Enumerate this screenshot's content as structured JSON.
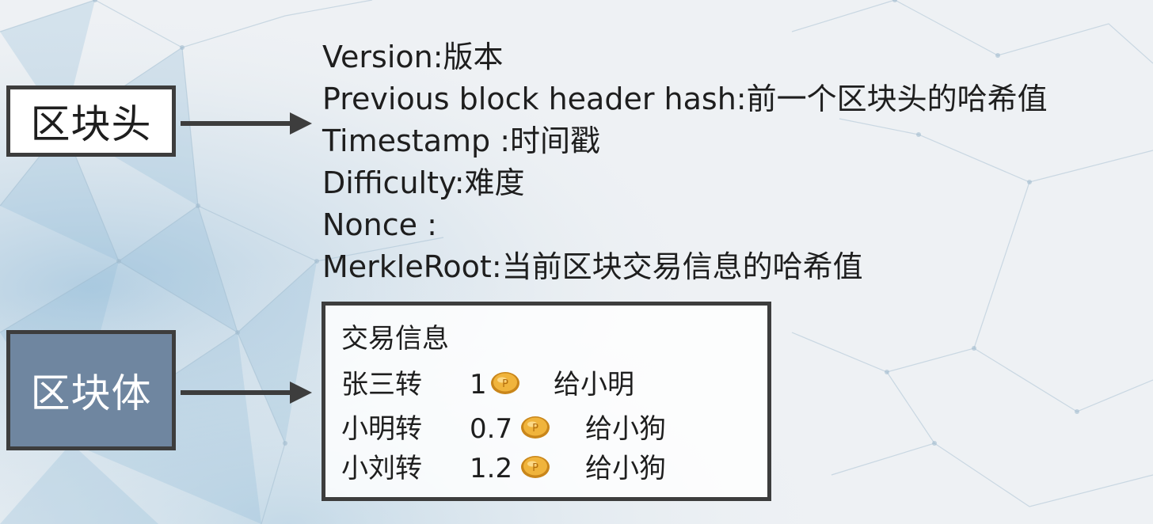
{
  "header_box": {
    "label": "区块头"
  },
  "body_box": {
    "label": "区块体"
  },
  "header_fields": [
    "Version:版本",
    "Previous block header hash:前一个区块头的哈希值",
    "Timestamp :时间戳",
    "Difficulty:难度",
    "Nonce :",
    "MerkleRoot:当前区块交易信息的哈希值"
  ],
  "transactions": {
    "title": "交易信息",
    "rows": [
      {
        "from": "张三转",
        "amount": "1",
        "icon": "coin-icon",
        "to": "给小明"
      },
      {
        "from": "小明转",
        "amount": "0.7",
        "icon": "coin-icon",
        "to": "给小狗"
      },
      {
        "from": "小刘转",
        "amount": "1.2",
        "icon": "coin-icon",
        "to": "给小狗"
      }
    ]
  },
  "colors": {
    "body_box_fill": "#6f86a0",
    "border": "#3d3d3d",
    "coin": "#e3a22a"
  }
}
